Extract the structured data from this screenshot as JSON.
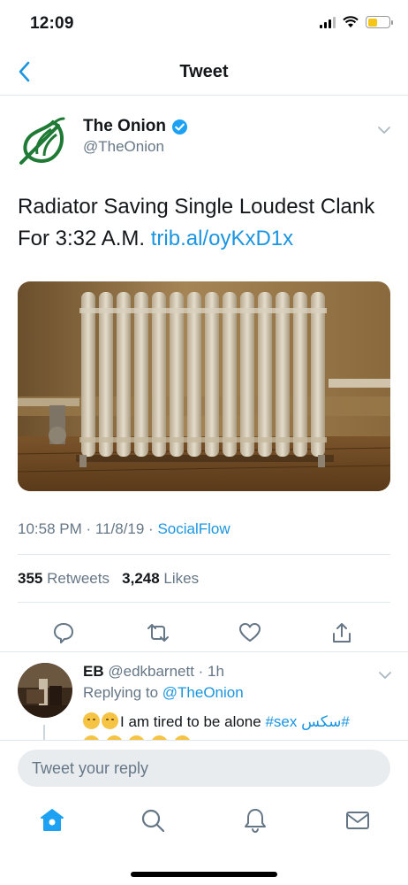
{
  "status_bar": {
    "time": "12:09"
  },
  "nav": {
    "title": "Tweet"
  },
  "tweet": {
    "author_name": "The Onion",
    "author_handle": "@TheOnion",
    "text_main": "Radiator Saving Single Loudest Clank For 3:32 A.M. ",
    "text_link": "trib.al/oyKxD1x",
    "time": "10:58 PM · 11/8/19 · ",
    "source": "SocialFlow",
    "retweets_count": "355",
    "retweets_label": " Retweets",
    "likes_count": "3,248",
    "likes_label": " Likes"
  },
  "reply": {
    "name": "EB",
    "handle": "@edkbarnett",
    "age": " · 1h",
    "replying_label": "Replying to ",
    "replying_to": "@TheOnion",
    "text": "I am tired to be alone ",
    "hashtag1": "#sex",
    "hashtag2": " سكس#"
  },
  "composer": {
    "placeholder": "Tweet your reply"
  },
  "colors": {
    "accent": "#1b95e0",
    "onion_green": "#1e7a35",
    "muted": "#657786"
  },
  "icons": [
    "back-chevron-icon",
    "verified-icon",
    "chevron-down-icon",
    "reply-icon",
    "retweet-icon",
    "like-icon",
    "share-icon",
    "home-icon",
    "search-icon",
    "notifications-icon",
    "messages-icon"
  ]
}
